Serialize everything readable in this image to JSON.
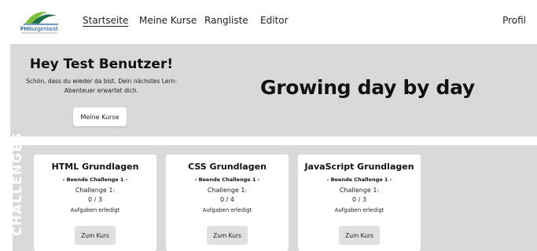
{
  "logo": {
    "text_prefix": "FH",
    "text_main": "Burgenland"
  },
  "nav": {
    "items": [
      {
        "label": "Startseite"
      },
      {
        "label": "Meine Kurse"
      },
      {
        "label": "Rangliste"
      },
      {
        "label": "Editor"
      }
    ],
    "active_index": 0,
    "profile_label": "Profil"
  },
  "hero": {
    "greeting": "Hey Test Benutzer!",
    "message": "Schön, dass du wieder da bist. Dein nächstes Lern-Abenteuer erwartet dich.",
    "button_label": "Meine Kurse",
    "slogan": "Growing day by day"
  },
  "challenges": {
    "section_label": "CHALLENGES",
    "cards": [
      {
        "title": "HTML Grundlagen",
        "subtitle": "- Beende Challenge 1 -",
        "challenge": "Challenge 1:",
        "progress": "0 / 3",
        "status": "Aufgaben erledigt",
        "button_label": "Zum Kurs"
      },
      {
        "title": "CSS Grundlagen",
        "subtitle": "- Beende Challenge 1 -",
        "challenge": "Challenge 1:",
        "progress": "0 / 4",
        "status": "Aufgaben erledigt",
        "button_label": "Zum Kurs"
      },
      {
        "title": "JavaScript Grundlagen",
        "subtitle": "- Beende Challenge 1 -",
        "challenge": "Challenge 1:",
        "progress": "0 / 3",
        "status": "Aufgaben erledigt",
        "button_label": "Zum Kurs"
      }
    ]
  },
  "colors": {
    "panel_gray": "#d9d9d9",
    "logo_green": "#7fbf3f",
    "logo_blue": "#1e5aa0",
    "button_gray": "#e0e0e0"
  }
}
